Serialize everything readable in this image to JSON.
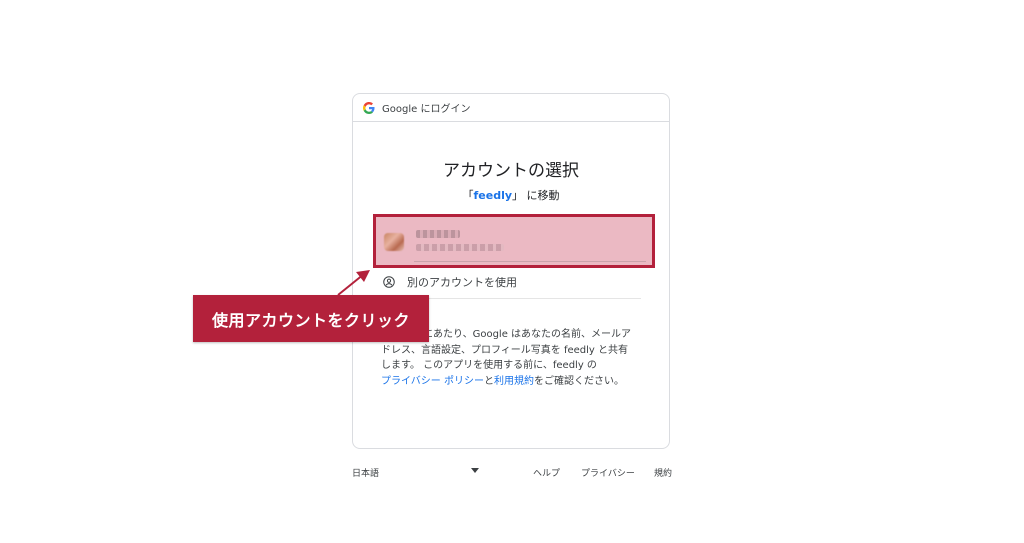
{
  "header": {
    "label": "Google にログイン",
    "icon": "google-g-icon"
  },
  "title": "アカウントの選択",
  "subtitle": {
    "open": "「",
    "app": "feedly",
    "close": "」",
    "rest": " に移動"
  },
  "account": {
    "avatar_icon": "avatar"
  },
  "other_account": {
    "icon": "person-circle-icon",
    "label": "別のアカウントを使用"
  },
  "legal": {
    "line1_tail": "にあたり、Google はあなたの名前、メールア",
    "line2": "ドレス、言語設定、プロフィール写真を feedly と共有",
    "line3": "します。 このアプリを使用する前に、feedly の",
    "privacy_link": "プライバシー ポリシー",
    "and": "と",
    "terms_link": "利用規約",
    "tail": "をご確認ください。"
  },
  "callout": {
    "label": "使用アカウントをクリック",
    "color": "#b3213b"
  },
  "footer": {
    "language": "日本語",
    "help": "ヘルプ",
    "privacy": "プライバシー",
    "terms": "規約"
  },
  "colors": {
    "link": "#1a73e8",
    "highlight_border": "#b3213b",
    "highlight_fill": "#ebb9c3"
  }
}
